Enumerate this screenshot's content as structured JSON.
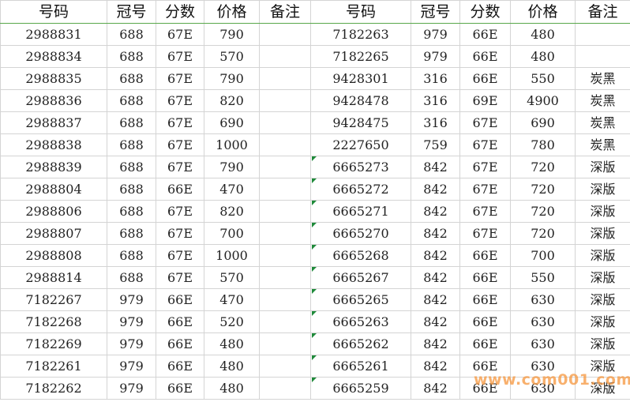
{
  "headers": [
    "号码",
    "冠号",
    "分数",
    "价格",
    "备注",
    "号码",
    "冠号",
    "分数",
    "价格",
    "备注"
  ],
  "rows": [
    {
      "l_num": "2988831",
      "l_crown": "688",
      "l_grade": "67E",
      "l_price": "790",
      "l_note": "",
      "r_num": "7182263",
      "r_crown": "979",
      "r_grade": "66E",
      "r_price": "480",
      "r_note": "",
      "r_color": "blue"
    },
    {
      "l_num": "2988834",
      "l_crown": "688",
      "l_grade": "67E",
      "l_price": "570",
      "l_note": "",
      "r_num": "7182265",
      "r_crown": "979",
      "r_grade": "66E",
      "r_price": "480",
      "r_note": "",
      "r_color": "blue"
    },
    {
      "l_num": "2988835",
      "l_crown": "688",
      "l_grade": "67E",
      "l_price": "790",
      "l_note": "",
      "r_num": "9428301",
      "r_crown": "316",
      "r_grade": "66E",
      "r_price": "550",
      "r_note": "炭黑",
      "r_color": "blue"
    },
    {
      "l_num": "2988836",
      "l_crown": "688",
      "l_grade": "67E",
      "l_price": "820",
      "l_note": "",
      "r_num": "9428478",
      "r_crown": "316",
      "r_grade": "69E",
      "r_price": "4900",
      "r_note": "炭黑",
      "r_color": "blue"
    },
    {
      "l_num": "2988837",
      "l_crown": "688",
      "l_grade": "67E",
      "l_price": "690",
      "l_note": "",
      "r_num": "9428475",
      "r_crown": "316",
      "r_grade": "67E",
      "r_price": "690",
      "r_note": "炭黑",
      "r_color": "blue"
    },
    {
      "l_num": "2988838",
      "l_crown": "688",
      "l_grade": "67E",
      "l_price": "1000",
      "l_note": "",
      "r_num": "2227650",
      "r_crown": "759",
      "r_grade": "67E",
      "r_price": "780",
      "r_note": "炭黑",
      "r_color": "blue"
    },
    {
      "l_num": "2988839",
      "l_crown": "688",
      "l_grade": "67E",
      "l_price": "790",
      "l_note": "",
      "r_num": "6665273",
      "r_crown": "842",
      "r_grade": "67E",
      "r_price": "720",
      "r_note": "深版",
      "r_color": "red"
    },
    {
      "l_num": "2988804",
      "l_crown": "688",
      "l_grade": "66E",
      "l_price": "470",
      "l_note": "",
      "r_num": "6665272",
      "r_crown": "842",
      "r_grade": "67E",
      "r_price": "720",
      "r_note": "深版",
      "r_color": "red"
    },
    {
      "l_num": "2988806",
      "l_crown": "688",
      "l_grade": "67E",
      "l_price": "820",
      "l_note": "",
      "r_num": "6665271",
      "r_crown": "842",
      "r_grade": "67E",
      "r_price": "720",
      "r_note": "深版",
      "r_color": "red"
    },
    {
      "l_num": "2988807",
      "l_crown": "688",
      "l_grade": "67E",
      "l_price": "700",
      "l_note": "",
      "r_num": "6665270",
      "r_crown": "842",
      "r_grade": "67E",
      "r_price": "720",
      "r_note": "深版",
      "r_color": "red"
    },
    {
      "l_num": "2988808",
      "l_crown": "688",
      "l_grade": "67E",
      "l_price": "1000",
      "l_note": "",
      "r_num": "6665268",
      "r_crown": "842",
      "r_grade": "66E",
      "r_price": "700",
      "r_note": "深版",
      "r_color": "red"
    },
    {
      "l_num": "2988814",
      "l_crown": "688",
      "l_grade": "67E",
      "l_price": "570",
      "l_note": "",
      "r_num": "6665267",
      "r_crown": "842",
      "r_grade": "66E",
      "r_price": "550",
      "r_note": "深版",
      "r_color": "red"
    },
    {
      "l_num": "7182267",
      "l_crown": "979",
      "l_grade": "66E",
      "l_price": "470",
      "l_note": "",
      "r_num": "6665265",
      "r_crown": "842",
      "r_grade": "66E",
      "r_price": "630",
      "r_note": "深版",
      "r_color": "red"
    },
    {
      "l_num": "7182268",
      "l_crown": "979",
      "l_grade": "66E",
      "l_price": "520",
      "l_note": "",
      "r_num": "6665263",
      "r_crown": "842",
      "r_grade": "66E",
      "r_price": "630",
      "r_note": "深版",
      "r_color": "red"
    },
    {
      "l_num": "7182269",
      "l_crown": "979",
      "l_grade": "66E",
      "l_price": "480",
      "l_note": "",
      "r_num": "6665262",
      "r_crown": "842",
      "r_grade": "66E",
      "r_price": "630",
      "r_note": "深版",
      "r_color": "red"
    },
    {
      "l_num": "7182261",
      "l_crown": "979",
      "l_grade": "66E",
      "l_price": "480",
      "l_note": "",
      "r_num": "6665261",
      "r_crown": "842",
      "r_grade": "66E",
      "r_price": "630",
      "r_note": "深版",
      "r_color": "red"
    },
    {
      "l_num": "7182262",
      "l_crown": "979",
      "l_grade": "66E",
      "l_price": "480",
      "l_note": "",
      "r_num": "6665259",
      "r_crown": "842",
      "r_grade": "66E",
      "r_price": "630",
      "r_note": "深版",
      "r_color": "red"
    }
  ],
  "watermark": "www.com001.com",
  "colors": {
    "blue_number": "#1a33a8",
    "red_number": "#d81e1e",
    "price": "#d42a2a",
    "grid": "#d4d4d4"
  }
}
